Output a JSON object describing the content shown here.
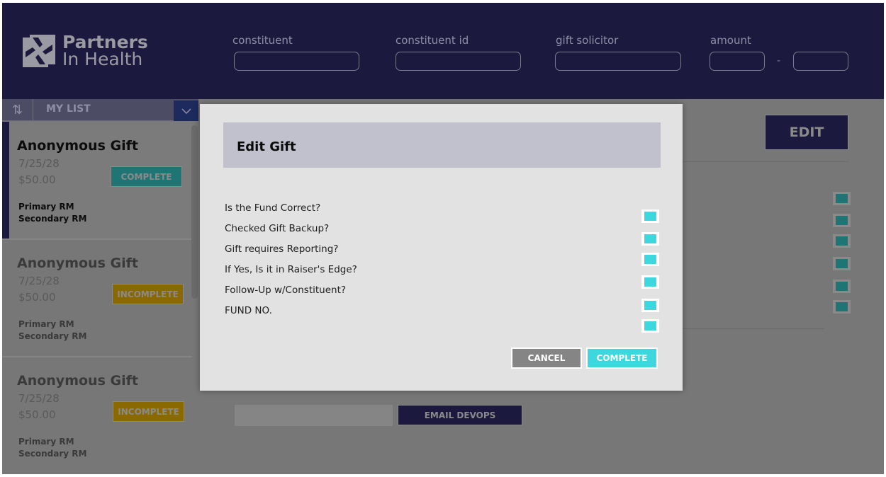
{
  "header": {
    "logo": {
      "line1": "Partners",
      "line2": "In Health",
      "icon": "hands-logo-icon"
    },
    "filters": {
      "constituent_label": "constituent",
      "constituent_id_label": "constituent id",
      "gift_solicitor_label": "gift solicitor",
      "amount_label": "amount",
      "amount_separator": "-",
      "constituent_value": "",
      "constituent_id_value": "",
      "gift_solicitor_value": "",
      "amount_min_value": "",
      "amount_max_value": ""
    }
  },
  "sidebar": {
    "sort_icon": "⇅",
    "list_label": "MY LIST",
    "dropdown_icon": "⌄",
    "gifts": [
      {
        "title": "Anonymous Gift",
        "date": "7/25/28",
        "amount": "$50.00",
        "status": "COMPLETE",
        "primary": "Primary RM",
        "secondary": "Secondary RM"
      },
      {
        "title": "Anonymous Gift",
        "date": "7/25/28",
        "amount": "$50.00",
        "status": "INCOMPLETE",
        "primary": "Primary RM",
        "secondary": "Secondary RM"
      },
      {
        "title": "Anonymous Gift",
        "date": "7/25/28",
        "amount": "$50.00",
        "status": "INCOMPLETE",
        "primary": "Primary RM",
        "secondary": "Secondary RM"
      }
    ]
  },
  "main": {
    "edit_label": "EDIT",
    "email_input_value": "",
    "email_button_label": "EMAIL DEVOPS"
  },
  "modal": {
    "title": "Edit Gift",
    "questions": [
      "Is the Fund Correct?",
      "Checked Gift Backup?",
      "Gift requires Reporting?",
      "If Yes, Is it in Raiser's Edge?",
      "Follow-Up w/Constituent?",
      "FUND NO."
    ],
    "cancel_label": "CANCEL",
    "complete_label": "COMPLETE"
  },
  "colors": {
    "header_bg": "#1b1a3e",
    "accent_cyan": "#3cd8de",
    "complete_teal": "#1f7474",
    "incomplete_gold": "#8a6a00",
    "modal_bg": "#e2e2e2",
    "modal_header_bg": "#c1c1cd"
  }
}
